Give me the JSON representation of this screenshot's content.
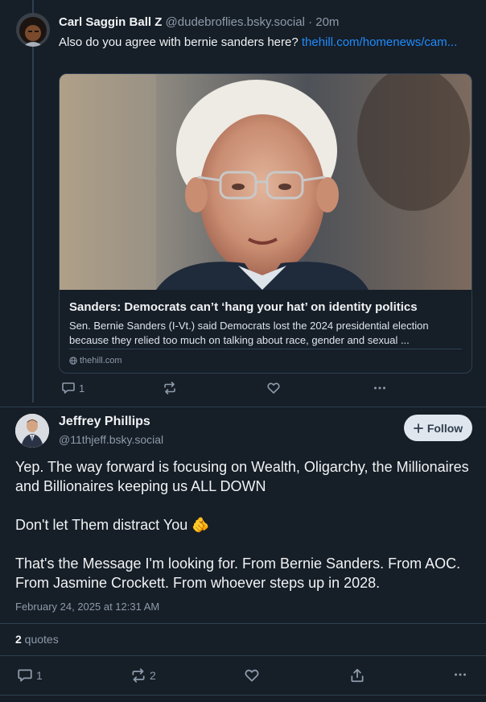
{
  "reply": {
    "author_name": "Carl Saggin Ball Z",
    "author_handle": "@dudebroflies.bsky.social",
    "separator": " · ",
    "time_ago": "20m",
    "text": "Also do you agree with bernie sanders here?",
    "link_text": "thehill.com/homenews/cam...",
    "link_card": {
      "title": "Sanders: Democrats can’t ‘hang your hat’ on identity politics",
      "description": "Sen. Bernie Sanders (I-Vt.) said Democrats lost the 2024 presidential election because they relied too much on talking about race, gender and sexual ...",
      "domain": "thehill.com"
    },
    "reply_count": "1",
    "icons": [
      "reply-icon",
      "repost-icon",
      "like-icon",
      "more-icon",
      "globe-icon"
    ]
  },
  "post": {
    "author_name": "Jeffrey Phillips",
    "author_handle": "@11thjeff.bsky.social",
    "follow_label": "Follow",
    "paragraphs": [
      "Yep. The way forward is focusing on Wealth, Oligarchy, the Millionaires and Billionaires keeping us ALL DOWN",
      "Don't let Them distract You 🫵",
      "That's the Message I'm looking for. From Bernie Sanders. From AOC. From Jasmine Crockett. From whoever steps up in 2028."
    ],
    "timestamp": "February 24, 2025 at 12:31 AM",
    "quotes_count": "2",
    "quotes_label": " quotes",
    "reply_count": "1",
    "repost_count": "2",
    "icons": [
      "reply-icon",
      "repost-icon",
      "like-icon",
      "share-icon",
      "more-icon",
      "plus-icon"
    ]
  },
  "colors": {
    "background": "#161e27",
    "border": "#2e4052",
    "muted": "#8d9bab",
    "link": "#208bfe",
    "follow_bg": "#dfe6ee"
  }
}
